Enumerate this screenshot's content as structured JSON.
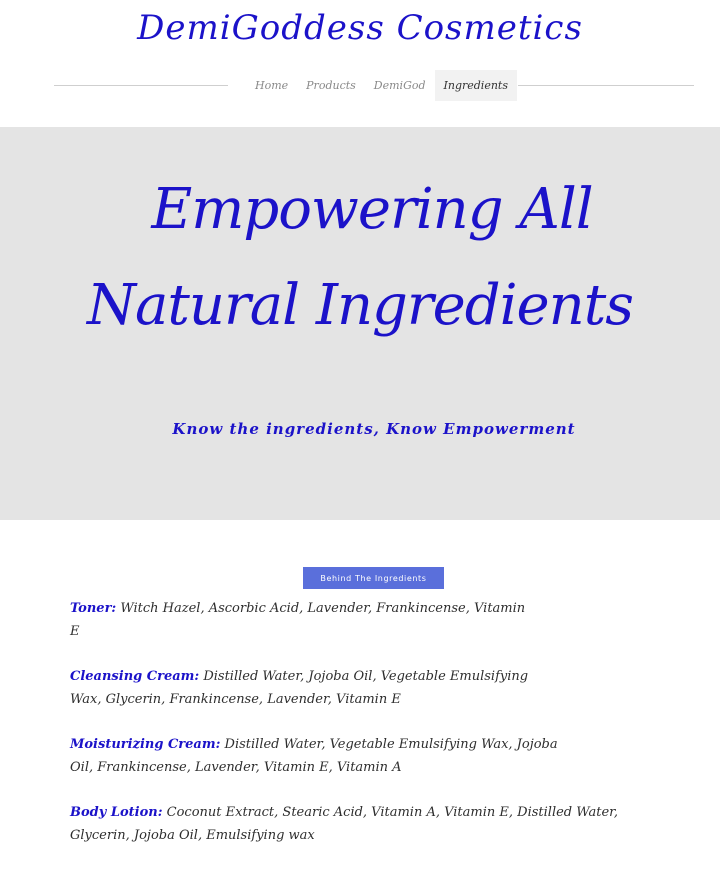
{
  "site": {
    "title": "DemiGoddess Cosmetics"
  },
  "nav": {
    "items": [
      {
        "label": "Home"
      },
      {
        "label": "Products"
      },
      {
        "label": "DemiGod"
      },
      {
        "label": "Ingredients",
        "active": true
      }
    ]
  },
  "hero": {
    "heading_line1": "Empowering All",
    "heading_line2": "Natural Ingredients",
    "subheading": "Know the ingredients, Know Empowerment",
    "background_color": "#e4e4e4",
    "text_color": "#1b12c9"
  },
  "cta": {
    "label": "Behind The Ingredients",
    "color": "#5a6fdb"
  },
  "ingredients": [
    {
      "label": "Toner:",
      "text": " Witch Hazel, Ascorbic Acid, Lavender, Frankincense, Vitamin E"
    },
    {
      "label": "Cleansing Cream:",
      "text": " Distilled Water, Jojoba Oil, Vegetable Emulsifying Wax, Glycerin, Frankincense, Lavender, Vitamin E"
    },
    {
      "label": "Moisturizing Cream:",
      "text": " Distilled Water, Vegetable Emulsifying Wax, Jojoba Oil, Frankincense, Lavender, Vitamin E, Vitamin A"
    },
    {
      "label": "Body Lotion:",
      "text": " Coconut Extract, Stearic Acid, Vitamin A, Vitamin E, Distilled Water, Glycerin, Jojoba Oil, Emulsifying wax"
    }
  ]
}
